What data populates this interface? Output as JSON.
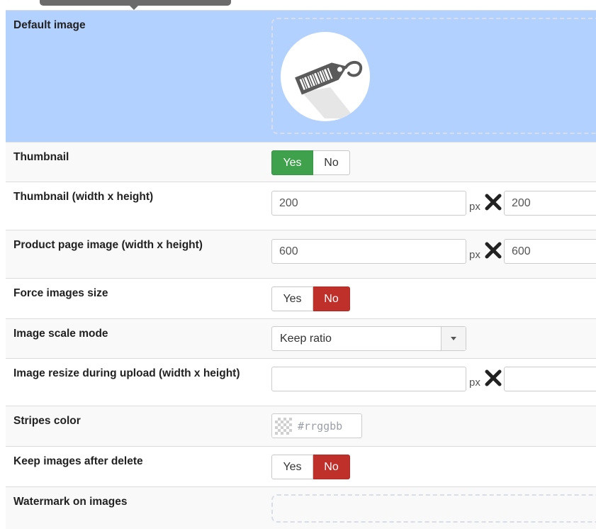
{
  "settings": {
    "default_image": {
      "label": "Default image",
      "icon": "price-tag-icon"
    },
    "thumbnail": {
      "label": "Thumbnail",
      "yes": "Yes",
      "no": "No",
      "selected": "Yes"
    },
    "thumbnail_size": {
      "label": "Thumbnail (width x height)",
      "width": "200",
      "height": "200",
      "unit": "px"
    },
    "product_page_size": {
      "label": "Product page image (width x height)",
      "width": "600",
      "height": "600",
      "unit": "px"
    },
    "force_images_size": {
      "label": "Force images size",
      "yes": "Yes",
      "no": "No",
      "selected": "No"
    },
    "image_scale_mode": {
      "label": "Image scale mode",
      "value": "Keep ratio"
    },
    "image_resize_upload": {
      "label": "Image resize during upload (width x height)",
      "width": "",
      "height": "",
      "unit": "px"
    },
    "stripes_color": {
      "label": "Stripes color",
      "placeholder": "#rrggbb"
    },
    "keep_images": {
      "label": "Keep images after delete",
      "yes": "Yes",
      "no": "No",
      "selected": "No"
    },
    "watermark": {
      "label": "Watermark on images"
    }
  },
  "colors": {
    "highlight_row": "#b3d1ff",
    "toggle_yes_active": "#40a14c",
    "toggle_no_active": "#c0302b"
  }
}
